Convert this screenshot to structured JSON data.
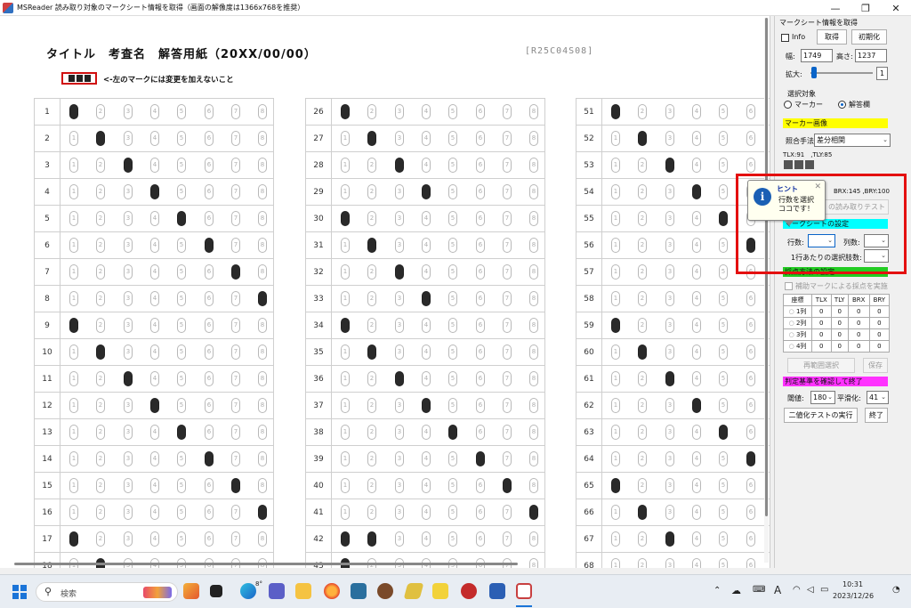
{
  "window": {
    "title": "MSReader 読み取り対象のマークシート情報を取得（画面の解像度は1366x768を推奨）",
    "minimize": "—",
    "maximize": "❐",
    "close": "✕"
  },
  "sheet": {
    "title": "タイトル　考査名　解答用紙（20XX/00/00）",
    "code": "[R25C04S08]",
    "marker_note": "<-左のマークには変更を加えないこと",
    "choice_labels": [
      "1",
      "2",
      "3",
      "4",
      "5",
      "6",
      "7",
      "8"
    ],
    "columns": [
      {
        "rows": [
          {
            "n": "1",
            "f": [
              0
            ]
          },
          {
            "n": "2",
            "f": [
              1
            ]
          },
          {
            "n": "3",
            "f": [
              2
            ]
          },
          {
            "n": "4",
            "f": [
              3
            ]
          },
          {
            "n": "5",
            "f": [
              4
            ]
          },
          {
            "n": "6",
            "f": [
              5
            ]
          },
          {
            "n": "7",
            "f": [
              6
            ]
          },
          {
            "n": "8",
            "f": [
              7
            ]
          },
          {
            "n": "9",
            "f": [
              0
            ]
          },
          {
            "n": "10",
            "f": [
              1
            ]
          },
          {
            "n": "11",
            "f": [
              2
            ]
          },
          {
            "n": "12",
            "f": [
              3
            ]
          },
          {
            "n": "13",
            "f": [
              4
            ]
          },
          {
            "n": "14",
            "f": [
              5
            ]
          },
          {
            "n": "15",
            "f": [
              6
            ]
          },
          {
            "n": "16",
            "f": [
              7
            ]
          },
          {
            "n": "17",
            "f": [
              0
            ]
          },
          {
            "n": "18",
            "f": [
              1
            ]
          }
        ]
      },
      {
        "rows": [
          {
            "n": "26",
            "f": [
              0
            ]
          },
          {
            "n": "27",
            "f": [
              1
            ]
          },
          {
            "n": "28",
            "f": [
              2
            ]
          },
          {
            "n": "29",
            "f": [
              3
            ]
          },
          {
            "n": "30",
            "f": [
              0
            ]
          },
          {
            "n": "31",
            "f": [
              1
            ]
          },
          {
            "n": "32",
            "f": [
              2
            ]
          },
          {
            "n": "33",
            "f": [
              3
            ]
          },
          {
            "n": "34",
            "f": [
              0
            ]
          },
          {
            "n": "35",
            "f": [
              1
            ]
          },
          {
            "n": "36",
            "f": [
              2
            ]
          },
          {
            "n": "37",
            "f": [
              3
            ]
          },
          {
            "n": "38",
            "f": [
              4
            ]
          },
          {
            "n": "39",
            "f": [
              5
            ]
          },
          {
            "n": "40",
            "f": [
              6
            ]
          },
          {
            "n": "41",
            "f": [
              7
            ]
          },
          {
            "n": "42",
            "f": [
              0,
              1
            ]
          },
          {
            "n": "43",
            "f": [
              0
            ]
          }
        ]
      },
      {
        "rows": [
          {
            "n": "51",
            "f": [
              0
            ]
          },
          {
            "n": "52",
            "f": [
              1
            ]
          },
          {
            "n": "53",
            "f": [
              2
            ]
          },
          {
            "n": "54",
            "f": [
              3
            ]
          },
          {
            "n": "55",
            "f": [
              4
            ]
          },
          {
            "n": "56",
            "f": [
              5
            ]
          },
          {
            "n": "57",
            "f": []
          },
          {
            "n": "58",
            "f": []
          },
          {
            "n": "59",
            "f": [
              0
            ]
          },
          {
            "n": "60",
            "f": [
              1
            ]
          },
          {
            "n": "61",
            "f": [
              2
            ]
          },
          {
            "n": "62",
            "f": [
              3
            ]
          },
          {
            "n": "63",
            "f": [
              4
            ]
          },
          {
            "n": "64",
            "f": [
              5
            ]
          },
          {
            "n": "65",
            "f": [
              0
            ]
          },
          {
            "n": "66",
            "f": [
              1
            ]
          },
          {
            "n": "67",
            "f": [
              2
            ]
          },
          {
            "n": "68",
            "f": []
          }
        ]
      }
    ]
  },
  "panel": {
    "section_title": "マークシート情報を取得",
    "info_label": "Info",
    "get_button": "取得",
    "init_button": "初期化",
    "width_label": "幅:",
    "width_value": "1749",
    "height_label": "高さ:",
    "height_value": "1237",
    "zoom_label": "拡大:",
    "zoom_value": "1",
    "select_target_label": "選択対象",
    "radio_marker": "マーカー",
    "radio_answer": "解答欄",
    "marker_image_header": "マーカー画像",
    "match_method_label": "照合手法",
    "match_method_value": "差分相関",
    "tl_coords": "TLX:91　,TLY:85",
    "br_coords": "BRX:145 ,BRY:100",
    "read_test_button": "の読み取りテスト",
    "mark_settings_header": "マークシートの設定",
    "rows_label": "行数:",
    "cols_label": "列数:",
    "per_row_label": "1行あたりの選択肢数:",
    "scoring_header": "採点方法の設定",
    "aux_mark_label": "補助マークによる採点を実施",
    "coord_table": {
      "headers": [
        "座標",
        "TLX",
        "TLY",
        "BRX",
        "BRY"
      ],
      "rows": [
        {
          "label": "1列",
          "v": [
            "0",
            "0",
            "0",
            "0"
          ]
        },
        {
          "label": "2列",
          "v": [
            "0",
            "0",
            "0",
            "0"
          ]
        },
        {
          "label": "3列",
          "v": [
            "0",
            "0",
            "0",
            "0"
          ]
        },
        {
          "label": "4列",
          "v": [
            "0",
            "0",
            "0",
            "0"
          ]
        }
      ]
    },
    "reselect_button": "再範囲選択",
    "save_button": "保存",
    "criteria_header": "判定基準を確認して終了",
    "threshold_label": "閾値:",
    "threshold_value": "180",
    "smooth_label": "平滑化:",
    "smooth_value": "41",
    "binarize_button": "二値化テストの実行",
    "finish_button": "終了",
    "colors": {
      "yellow": "#ffff00",
      "cyan": "#00ffff",
      "green": "#22cc22",
      "magenta": "#ff33ff"
    }
  },
  "hint": {
    "title": "ヒント",
    "line1": "行数を選択",
    "line2": "ココです！",
    "icon": "info-icon"
  },
  "taskbar": {
    "search_placeholder": "検索",
    "time": "10:31",
    "date": "2023/12/26",
    "ime": "A",
    "weather_badge": "8°",
    "apps": [
      "widgets-icon",
      "task-view-icon",
      "edge-icon",
      "teams-icon",
      "file-explorer-icon",
      "firefox-icon",
      "remote-desktop-icon",
      "app-icon",
      "app-icon",
      "app-icon",
      "app-icon",
      "word-icon",
      "msreader-icon"
    ]
  }
}
